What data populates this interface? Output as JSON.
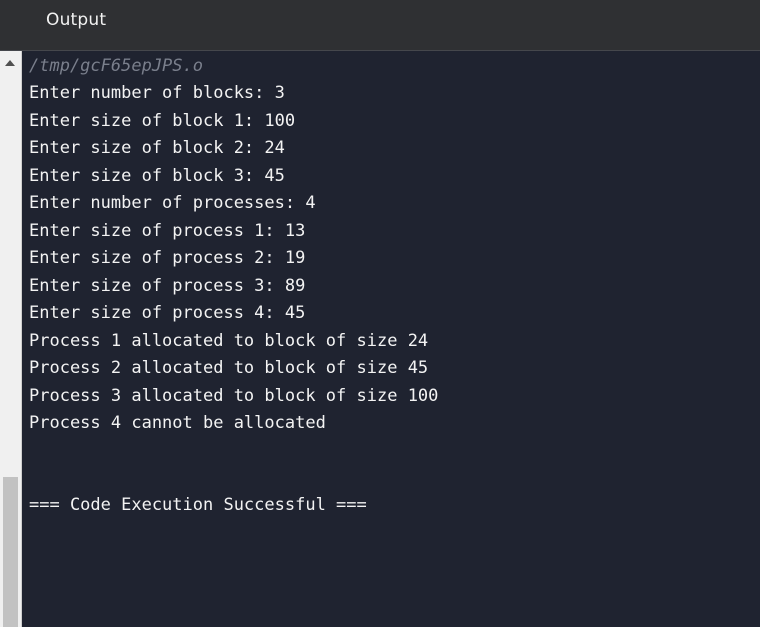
{
  "panel": {
    "title": "Output"
  },
  "console": {
    "file_path": "/tmp/gcF65epJPS.o",
    "lines": [
      "Enter number of blocks: 3",
      "Enter size of block 1: 100",
      "Enter size of block 2: 24",
      "Enter size of block 3: 45",
      "Enter number of processes: 4",
      "Enter size of process 1: 13",
      "Enter size of process 2: 19",
      "Enter size of process 3: 89",
      "Enter size of process 4: 45",
      "Process 1 allocated to block of size 24",
      "Process 2 allocated to block of size 45",
      "Process 3 allocated to block of size 100",
      "Process 4 cannot be allocated"
    ],
    "status": "=== Code Execution Successful ==="
  },
  "colors": {
    "console_background": "#1f2330",
    "header_background": "#2f3033",
    "text": "#f3f3f3",
    "path_text": "#7a7f8c"
  }
}
